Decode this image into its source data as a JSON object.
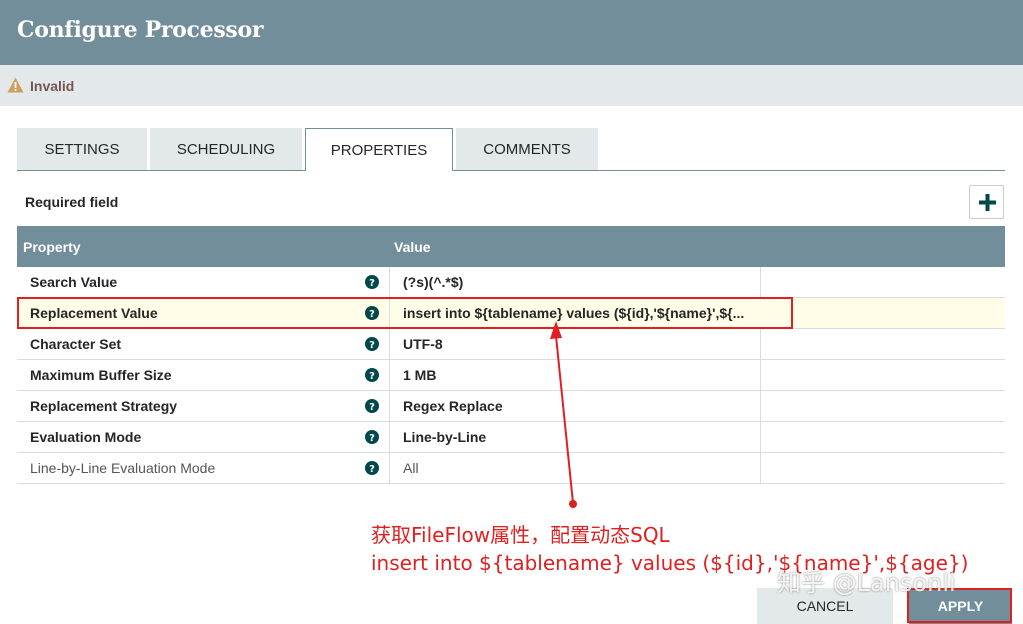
{
  "dialog": {
    "title": "Configure Processor"
  },
  "status": {
    "icon": "warning-icon",
    "text": "Invalid"
  },
  "tabs": [
    {
      "label": "SETTINGS",
      "active": false
    },
    {
      "label": "SCHEDULING",
      "active": false
    },
    {
      "label": "PROPERTIES",
      "active": true
    },
    {
      "label": "COMMENTS",
      "active": false
    }
  ],
  "properties": {
    "required_label": "Required field",
    "add_icon": "plus-icon",
    "columns": {
      "property": "Property",
      "value": "Value"
    },
    "rows": [
      {
        "name": "Search Value",
        "value": "(?s)(^.*$)"
      },
      {
        "name": "Replacement Value",
        "value": "insert into ${tablename} values (${id},'${name}',${..."
      },
      {
        "name": "Character Set",
        "value": "UTF-8"
      },
      {
        "name": "Maximum Buffer Size",
        "value": "1 MB"
      },
      {
        "name": "Replacement Strategy",
        "value": "Regex Replace"
      },
      {
        "name": "Evaluation Mode",
        "value": "Line-by-Line"
      },
      {
        "name": "Line-by-Line Evaluation Mode",
        "value": "All"
      }
    ]
  },
  "annotation": {
    "line1": "获取FileFlow属性，配置动态SQL",
    "line2": "insert into ${tablename} values (${id},'${name}',${age})"
  },
  "watermark": "知乎 @Lansonli",
  "footer": {
    "cancel_label": "CANCEL",
    "apply_label": "APPLY"
  },
  "colors": {
    "header": "#728e9b",
    "tab_bg": "#e3e8eb",
    "annotation": "#e02020",
    "selected_row": "#fffde7"
  }
}
